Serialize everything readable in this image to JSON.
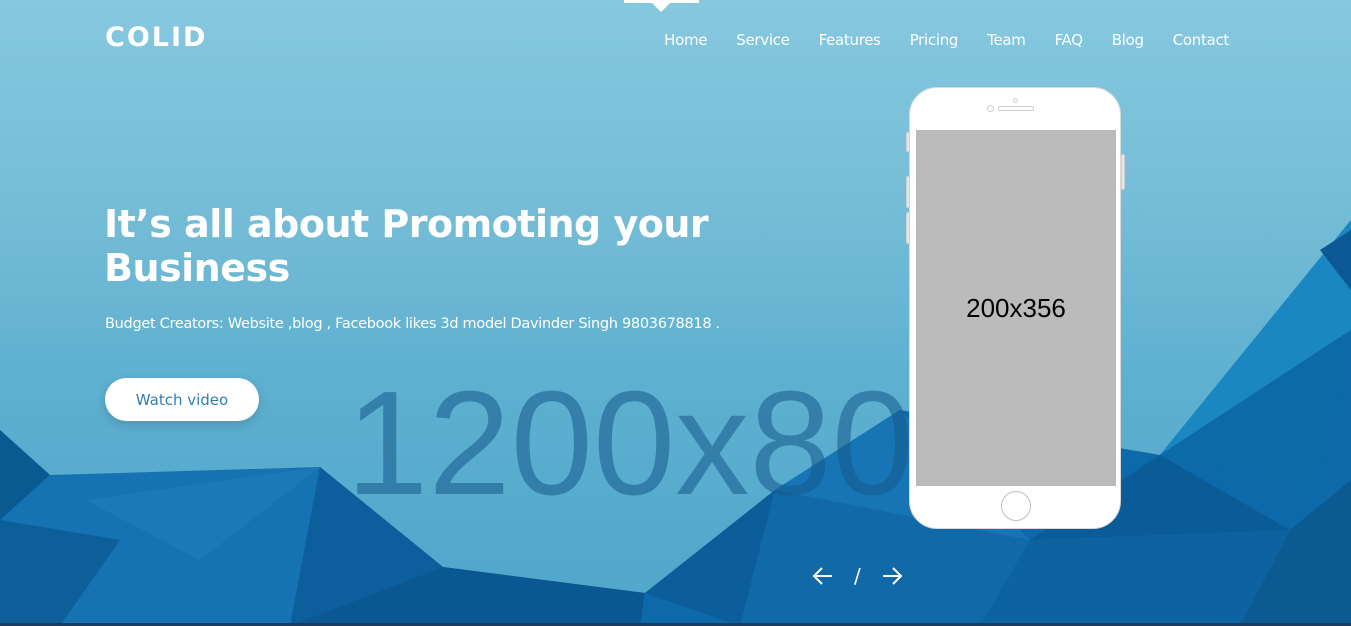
{
  "brand": {
    "logo": "COLID"
  },
  "nav": {
    "items": [
      "Home",
      "Service",
      "Features",
      "Pricing",
      "Team",
      "FAQ",
      "Blog",
      "Contact"
    ],
    "active": "Home"
  },
  "hero": {
    "headline": "It’s all about Promoting your Business",
    "subtext": "Budget Creators: Website ,blog , Facebook likes 3d model Davinder Singh 9803678818 .",
    "cta_label": "Watch video",
    "background_placeholder": "1200x800"
  },
  "phone": {
    "screen_placeholder": "200x356"
  },
  "slider": {
    "prev_icon": "arrow-left-icon",
    "separator": "/",
    "next_icon": "arrow-right-icon"
  },
  "colors": {
    "accent": "#2f7fb3",
    "background_top": "#86c8df",
    "background_bottom": "#4ea6ca",
    "polygon_dark": "#0a5d9c"
  }
}
